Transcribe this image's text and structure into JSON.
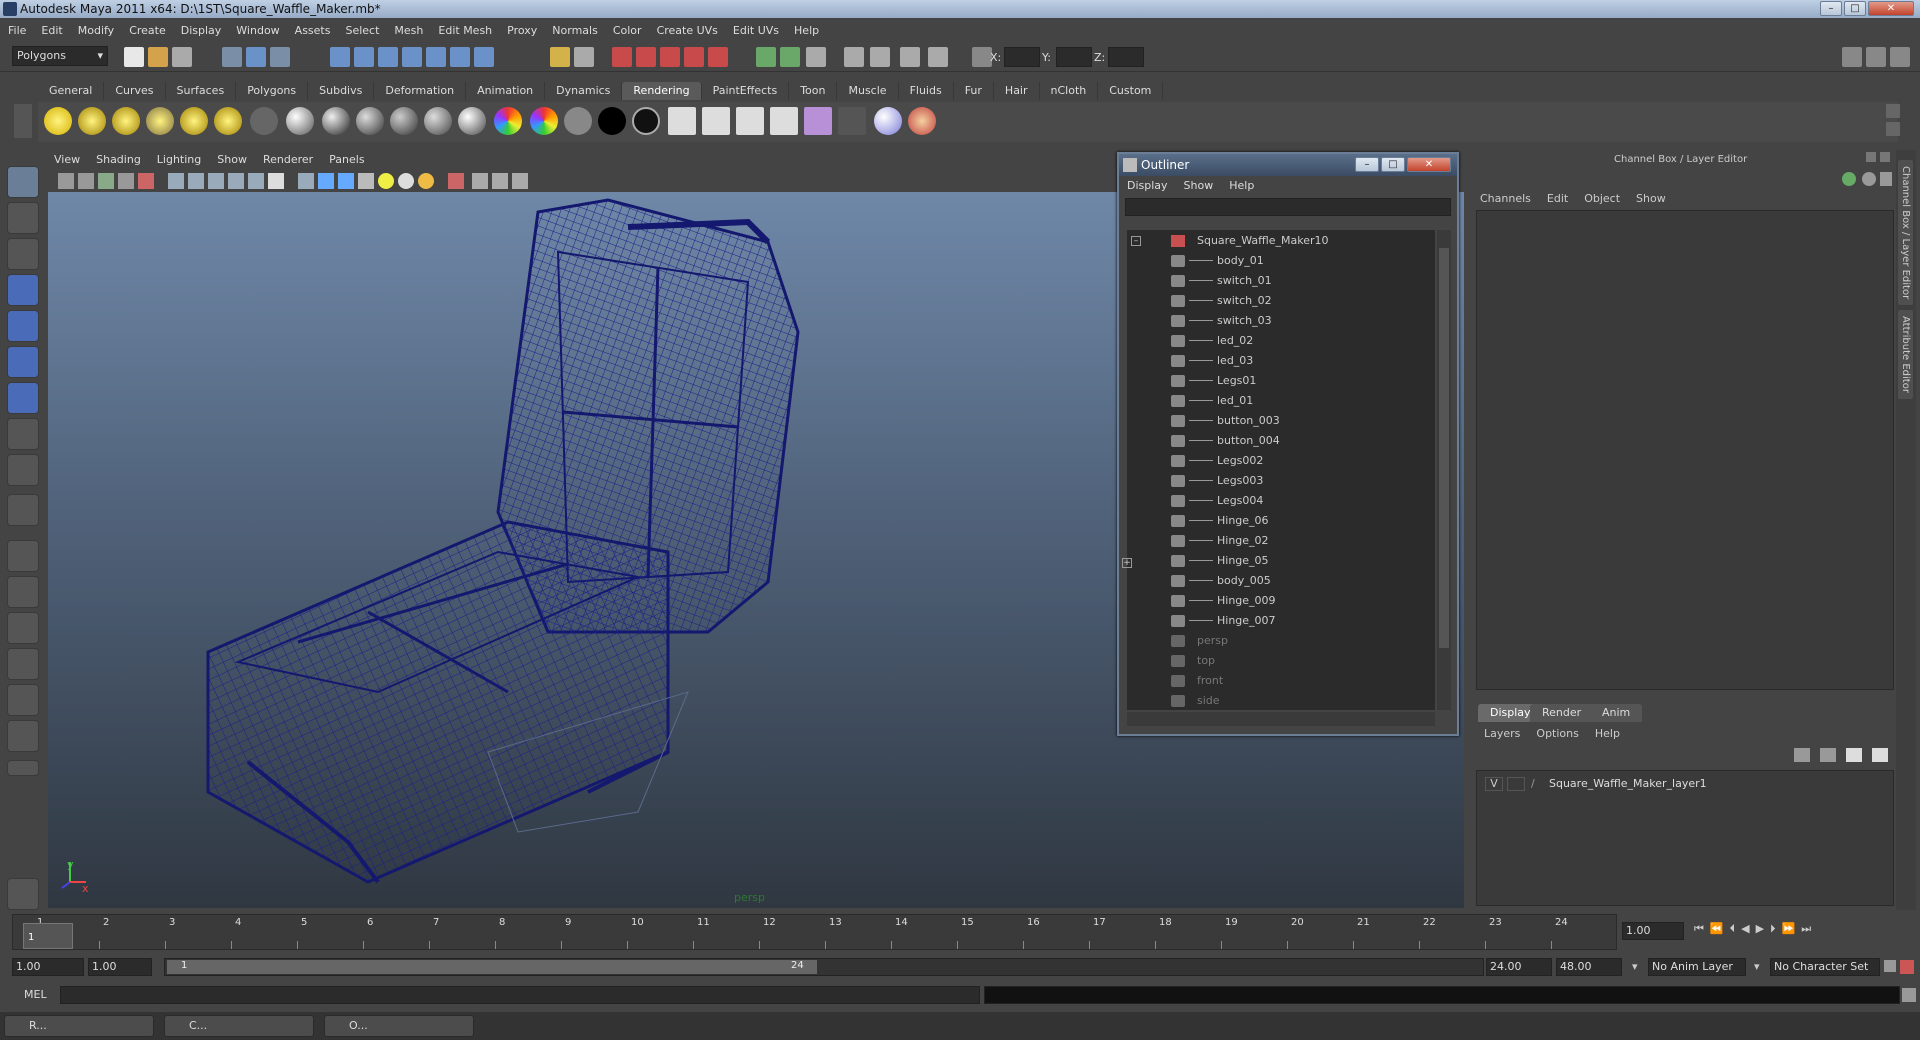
{
  "window": {
    "title": "Autodesk Maya 2011 x64: D:\\1ST\\Square_Waffle_Maker.mb*"
  },
  "menu": [
    "File",
    "Edit",
    "Modify",
    "Create",
    "Display",
    "Window",
    "Assets",
    "Select",
    "Mesh",
    "Edit Mesh",
    "Proxy",
    "Normals",
    "Color",
    "Create UVs",
    "Edit UVs",
    "Help"
  ],
  "toolbar": {
    "mode": "Polygons",
    "x_label": "X:",
    "y_label": "Y:",
    "z_label": "Z:"
  },
  "shelf_tabs": [
    "General",
    "Curves",
    "Surfaces",
    "Polygons",
    "Subdivs",
    "Deformation",
    "Animation",
    "Dynamics",
    "Rendering",
    "PaintEffects",
    "Toon",
    "Muscle",
    "Fluids",
    "Fur",
    "Hair",
    "nCloth",
    "Custom"
  ],
  "shelf_active": "Rendering",
  "viewport": {
    "menu": [
      "View",
      "Shading",
      "Lighting",
      "Show",
      "Renderer",
      "Panels"
    ],
    "camera_label": "persp",
    "axis_y": "y",
    "axis_x": "x"
  },
  "outliner": {
    "title": "Outliner",
    "menu": [
      "Display",
      "Show",
      "Help"
    ],
    "root": "Square_Waffle_Maker10",
    "children": [
      "body_01",
      "switch_01",
      "switch_02",
      "switch_03",
      "led_02",
      "led_03",
      "Legs01",
      "led_01",
      "button_003",
      "button_004",
      "Legs002",
      "Legs003",
      "Legs004",
      "Hinge_06",
      "Hinge_02",
      "Hinge_05",
      "body_005",
      "Hinge_009",
      "Hinge_007"
    ],
    "cameras": [
      "persp",
      "top",
      "front",
      "side"
    ]
  },
  "channel_box": {
    "title": "Channel Box / Layer Editor",
    "menu": [
      "Channels",
      "Edit",
      "Object",
      "Show"
    ],
    "side_tabs": [
      "Channel Box / Layer Editor",
      "Attribute Editor"
    ],
    "layer_tabs": [
      "Display",
      "Render",
      "Anim"
    ],
    "layer_tab_active": "Display",
    "layer_menu": [
      "Layers",
      "Options",
      "Help"
    ],
    "layer_visible": "V",
    "layer_name": "Square_Waffle_Maker_layer1"
  },
  "timeline": {
    "ticks": [
      "1",
      "2",
      "3",
      "4",
      "5",
      "6",
      "7",
      "8",
      "9",
      "10",
      "11",
      "12",
      "13",
      "14",
      "15",
      "16",
      "17",
      "18",
      "19",
      "20",
      "21",
      "22",
      "23",
      "24"
    ],
    "current_frame": "1.00",
    "current_marker": "1"
  },
  "range": {
    "start": "1.00",
    "anim_start": "1.00",
    "slider_start": "1",
    "slider_end": "24",
    "end": "24.00",
    "anim_end": "48.00",
    "anim_layer": "No Anim Layer",
    "char_set": "No Character Set"
  },
  "command": {
    "label": "MEL"
  },
  "taskbar": [
    "R...",
    "C...",
    "O..."
  ]
}
